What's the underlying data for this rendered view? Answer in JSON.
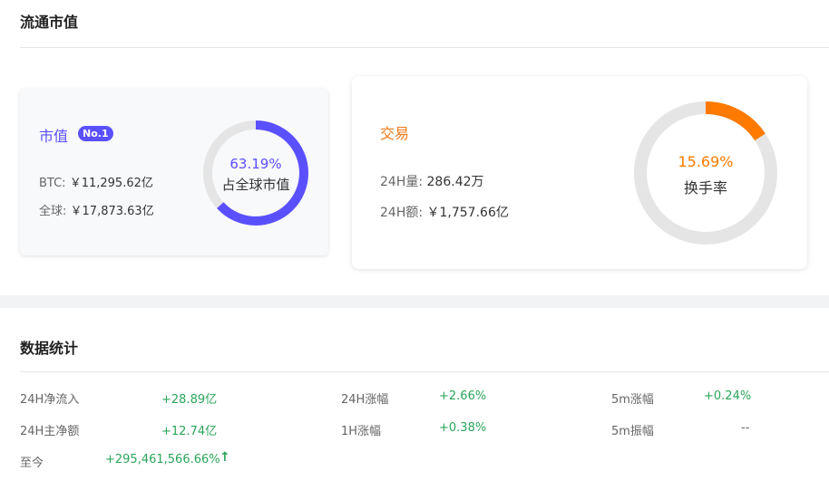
{
  "market_cap_section": {
    "title": "流通市值",
    "market_cap_card": {
      "title": "市值",
      "rank_badge": "No.1",
      "btc_label": "BTC:",
      "btc_value": "￥11,295.62亿",
      "global_label": "全球:",
      "global_value": "￥17,873.63亿",
      "ring": {
        "percent_text": "63.19%",
        "label": "占全球市值",
        "fraction": 0.6319,
        "color": "#5b50ff"
      }
    },
    "trade_card": {
      "title": "交易",
      "volume_label": "24H量:",
      "volume_value": "286.42万",
      "amount_label": "24H额:",
      "amount_value": "￥1,757.66亿",
      "ring": {
        "percent_text": "15.69%",
        "label": "换手率",
        "fraction": 0.1569,
        "color": "#ff7a00"
      }
    }
  },
  "stats_section": {
    "title": "数据统计",
    "items": [
      {
        "label": "24H净流入",
        "value": "+28.89亿"
      },
      {
        "label": "24H涨幅",
        "value": "+2.66%"
      },
      {
        "label": "5m涨幅",
        "value": "+0.24%"
      },
      {
        "label": "24H主净额",
        "value": "+12.74亿"
      },
      {
        "label": "1H涨幅",
        "value": "+0.38%"
      },
      {
        "label": "5m振幅",
        "value": "--"
      },
      {
        "label": "至今",
        "value": "+295,461,566.66%"
      }
    ]
  },
  "colors": {
    "accent_purple": "#5b50ff",
    "accent_orange": "#f27b1c",
    "positive_green": "#2aa55a"
  }
}
